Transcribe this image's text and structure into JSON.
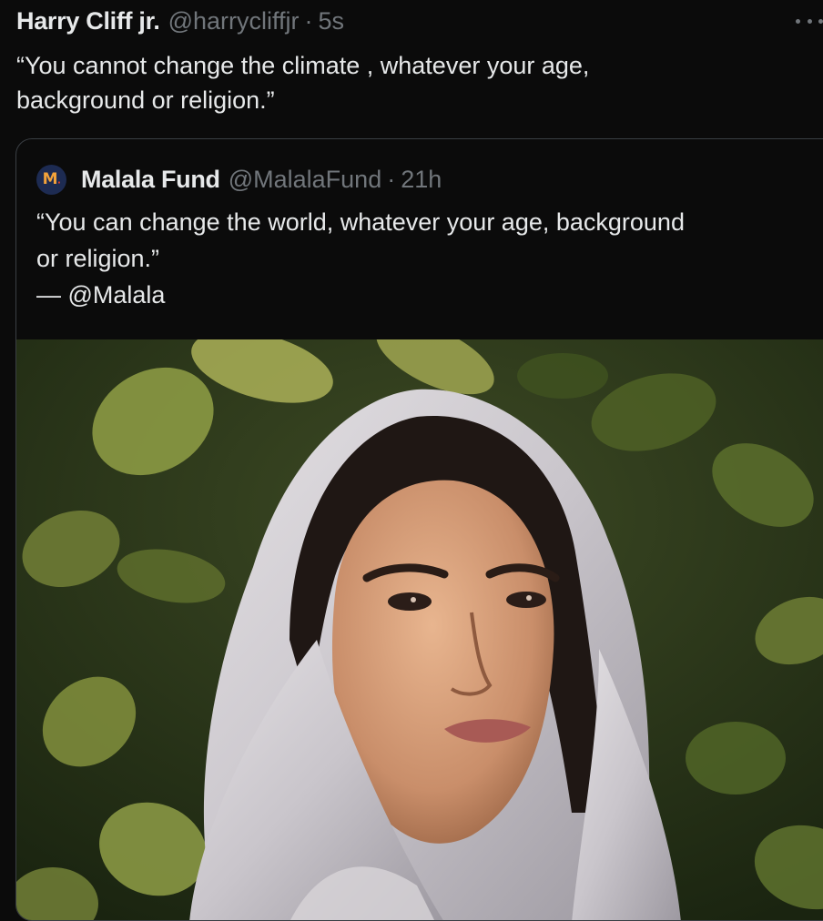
{
  "tweet": {
    "author_name": "Harry Cliff jr.",
    "author_handle": "@harrycliffjr",
    "separator": "·",
    "timestamp": "5s",
    "text": "“You cannot change the climate , whatever your age,\nbackground or religion.”",
    "more_icon": "more-dots-icon"
  },
  "quote": {
    "avatar_letter": "M",
    "avatar_icon": "malala-fund-logo",
    "author_name": "Malala Fund",
    "author_handle": "@MalalaFund",
    "separator": "·",
    "timestamp": "21h",
    "text": "“You can change the world, whatever your age, background\nor religion.”\n— @Malala",
    "media_description_icon": "photo-image"
  },
  "colors": {
    "background": "#0b0b0b",
    "text_primary": "#e7e9ea",
    "text_secondary": "#71767b",
    "card_border": "#3a3f44"
  }
}
